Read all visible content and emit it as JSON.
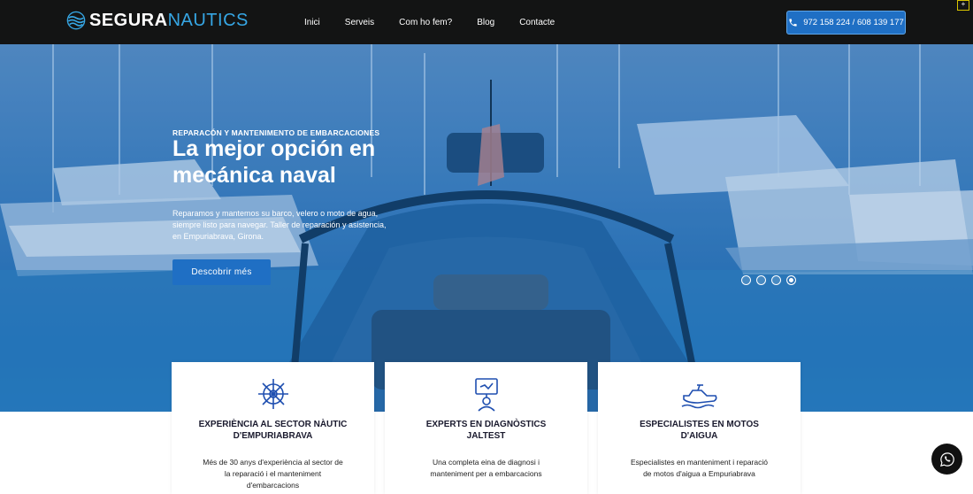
{
  "brand": {
    "part1": "SEGURA",
    "part2": "NAUTICS",
    "icon": "wave-globe-icon"
  },
  "nav": {
    "items": [
      {
        "label": "Inici"
      },
      {
        "label": "Serveis"
      },
      {
        "label": "Com ho fem?"
      },
      {
        "label": "Blog"
      },
      {
        "label": "Contacte"
      }
    ],
    "phone": "972 158 224 / 608 139 177",
    "phone_icon": "phone-icon"
  },
  "hero": {
    "kicker": "REPARACÓN Y MANTENIMENTO DE EMBARCACIONES",
    "title": "La mejor opción en mecánica naval",
    "description": "Reparamos y mantemos su barco, velero o moto de agua, siempre listo para navegar. Taller de reparación y asistencia, en Empuriabrava, Girona.",
    "cta": "Descobrir més",
    "slides": 4,
    "active_slide": 4
  },
  "features": [
    {
      "icon": "ship-wheel-icon",
      "title": "EXPERIÈNCIA AL SECTOR NÀUTIC D'EMPURIABRAVA",
      "text": "Més de 30 anys d'experiència al sector de la reparació i el manteniment d'embarcacions"
    },
    {
      "icon": "diagnostic-computer-icon",
      "title": "EXPERTS EN DIAGNÒSTICS JALTEST",
      "text": "Una completa eina de diagnosi i manteniment per a embarcacions"
    },
    {
      "icon": "jet-ski-icon",
      "title": "ESPECIALISTES EN MOTOS D'AIGUA",
      "text": "Especialistes en manteniment i reparació de motos d'aigua a Empuriabrava"
    }
  ],
  "colors": {
    "nav_bg": "#131414",
    "accent": "#1f6fc4",
    "brand_blue": "#36a6e4"
  },
  "whatsapp_icon": "whatsapp-icon"
}
